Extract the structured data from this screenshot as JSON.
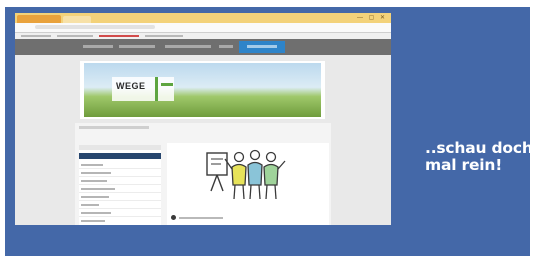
{
  "screenshot": {
    "header": {
      "logo_text": "WEGE"
    },
    "sidebar": {
      "items": [
        "",
        "",
        "",
        "",
        "",
        "",
        "",
        ""
      ]
    }
  },
  "tagline": "..schau doch mal rein!",
  "colors": {
    "banner_bg": "#4468a8",
    "nav_bg": "#6f6f6f",
    "nav_active": "#2e84c9",
    "sidebar_active": "#27466e",
    "tagline_text": "#ffffff"
  },
  "icons": [
    "team-illustration-icon",
    "radio-bullet-icon"
  ]
}
